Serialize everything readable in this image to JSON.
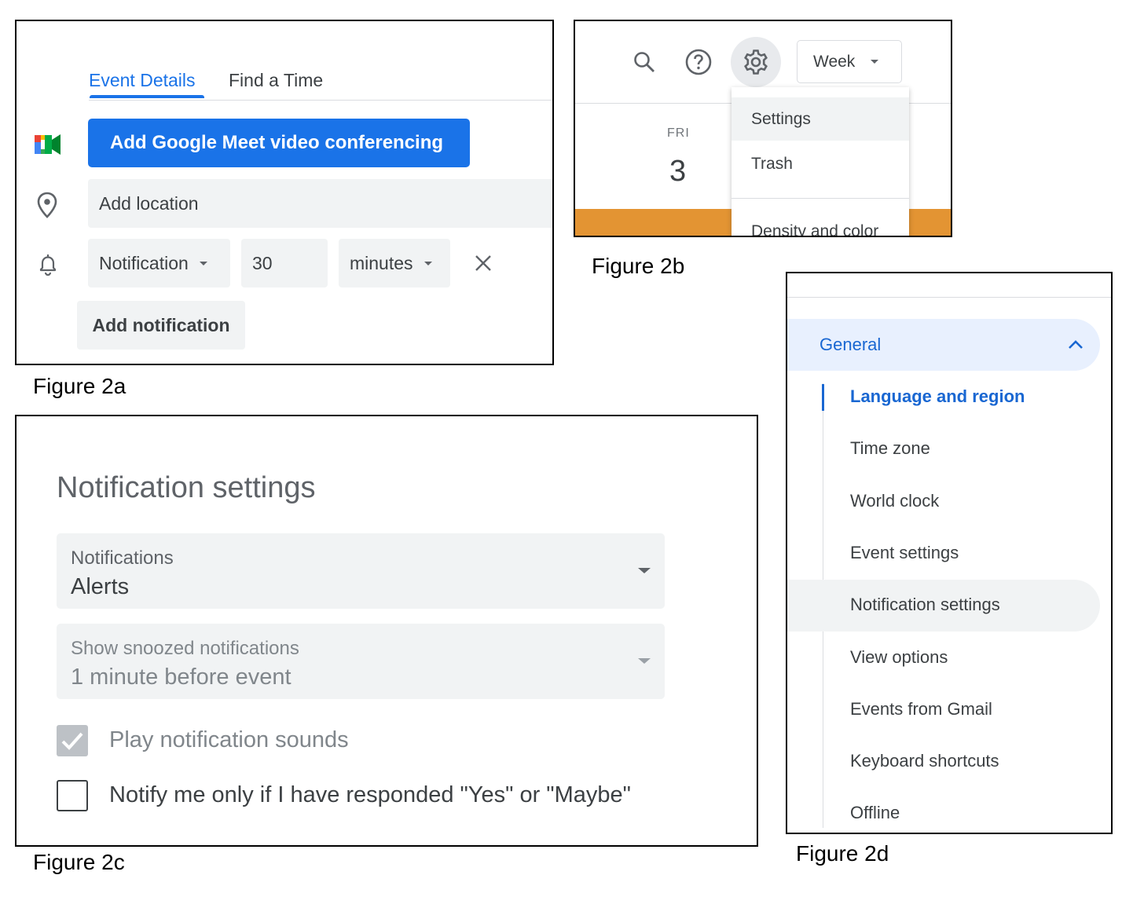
{
  "figure_2a": {
    "caption": "Figure 2a",
    "tabs": [
      {
        "label": "Event Details",
        "active": true
      },
      {
        "label": "Find a Time",
        "active": false
      }
    ],
    "meet_button": "Add Google Meet video conferencing",
    "location_placeholder": "Add location",
    "notification": {
      "type": "Notification",
      "amount": "30",
      "unit": "minutes"
    },
    "add_notification_button": "Add notification",
    "icons": [
      "google-meet-icon",
      "location-pin-icon",
      "bell-icon",
      "close-icon",
      "dropdown-caret-icon"
    ],
    "accent_color": "#1a73e8"
  },
  "figure_2b": {
    "caption": "Figure 2b",
    "icons": [
      "search-icon",
      "help-icon",
      "settings-gear-icon",
      "dropdown-caret-icon"
    ],
    "view_selector": "Week",
    "day": {
      "weekday": "FRI",
      "date": "3"
    },
    "menu_items": [
      {
        "label": "Settings",
        "highlighted": true
      },
      {
        "label": "Trash",
        "highlighted": false
      },
      {
        "label": "Density and color",
        "highlighted": false
      }
    ],
    "event_color": "#e39433"
  },
  "figure_2c": {
    "caption": "Figure 2c",
    "title": "Notification settings",
    "notifications_select": {
      "label": "Notifications",
      "value": "Alerts"
    },
    "snoozed_select": {
      "label": "Show snoozed notifications",
      "value": "1 minute before event",
      "disabled": true
    },
    "checkboxes": [
      {
        "label": "Play notification sounds",
        "checked": true,
        "disabled": true
      },
      {
        "label": "Notify me only if I have responded \"Yes\" or \"Maybe\"",
        "checked": false,
        "disabled": false
      }
    ]
  },
  "figure_2d": {
    "caption": "Figure 2d",
    "section": {
      "label": "General",
      "expanded": true
    },
    "items": [
      {
        "label": "Language and region",
        "active": true
      },
      {
        "label": "Time zone",
        "active": false
      },
      {
        "label": "World clock",
        "active": false
      },
      {
        "label": "Event settings",
        "active": false
      },
      {
        "label": "Notification settings",
        "hover": true
      },
      {
        "label": "View options",
        "active": false
      },
      {
        "label": "Events from Gmail",
        "active": false
      },
      {
        "label": "Keyboard shortcuts",
        "active": false
      },
      {
        "label": "Offline",
        "active": false
      }
    ],
    "icons": [
      "chevron-up-icon"
    ]
  }
}
